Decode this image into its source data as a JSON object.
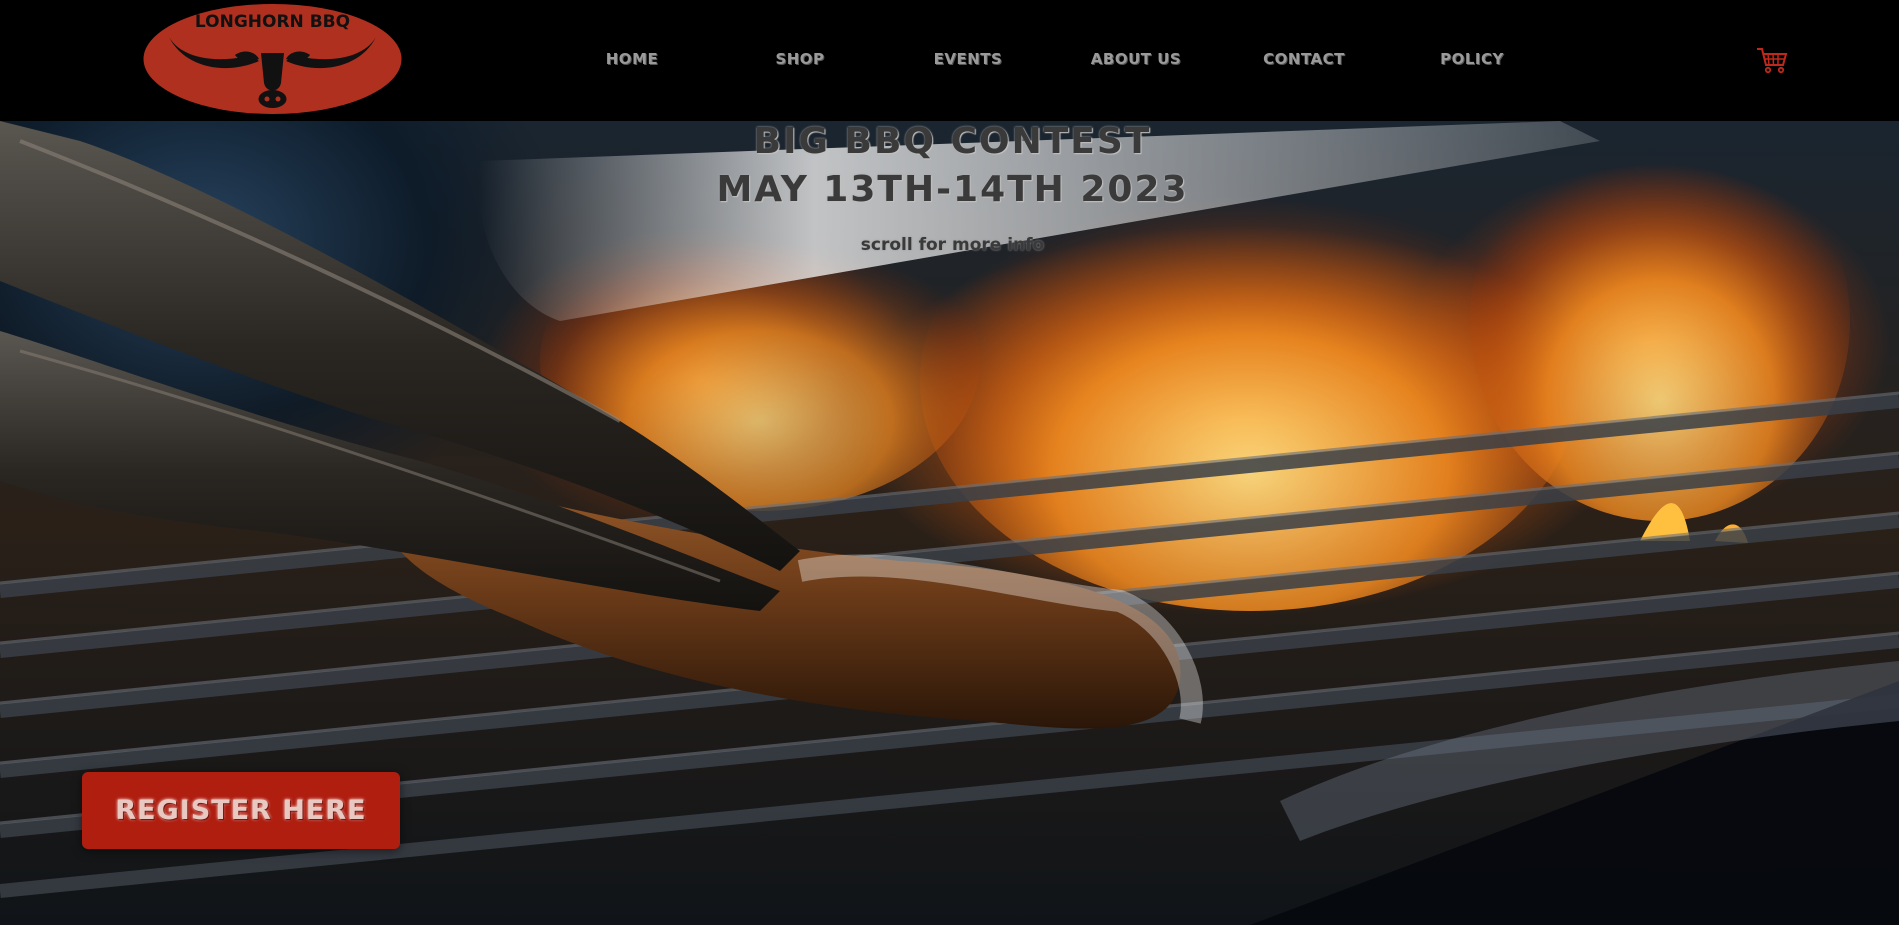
{
  "brand": {
    "logo_text": "LONGHORN BBQ",
    "logo_color": "#b0301f"
  },
  "nav": {
    "items": [
      {
        "label": "HOME"
      },
      {
        "label": "SHOP"
      },
      {
        "label": "EVENTS"
      },
      {
        "label": "ABOUT US"
      },
      {
        "label": "CONTACT"
      },
      {
        "label": "POLICY"
      }
    ]
  },
  "cart": {
    "icon": "cart-icon",
    "color": "#c0281a"
  },
  "hero": {
    "title_line1": "BIG BBQ CONTEST",
    "title_line2": "MAY 13TH-14TH 2023",
    "scroll_hint": "scroll for more info",
    "register_label": "REGISTER HERE",
    "register_color": "#b01e10",
    "image": "grilled-sausage-with-tongs-over-flames"
  }
}
